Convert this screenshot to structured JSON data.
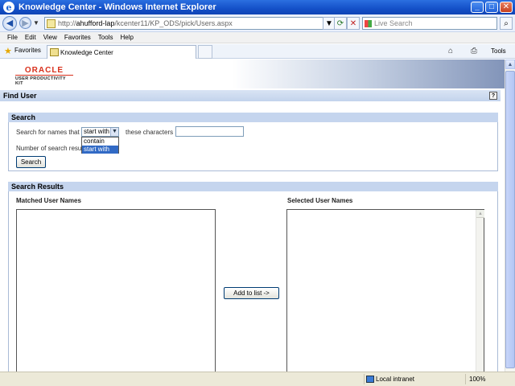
{
  "window": {
    "title": "Knowledge Center - Windows Internet Explorer",
    "controls": {
      "minimize": "_",
      "maximize": "□",
      "close": "✕"
    }
  },
  "address_bar": {
    "url_prefix": "http://",
    "url_host": "ahufford-lap",
    "url_path": "/kcenter11/KP_ODS/pick/Users.aspx",
    "search_placeholder": "Live Search"
  },
  "menu": [
    "File",
    "Edit",
    "View",
    "Favorites",
    "Tools",
    "Help"
  ],
  "favorites_bar": {
    "favorites_label": "Favorites",
    "tab_title": "Knowledge Center",
    "tools_label": "Tools"
  },
  "page": {
    "logo": {
      "brand": "ORACLE",
      "product": "USER PRODUCTIVITY KIT"
    },
    "find_title": "Find User",
    "help_label": "?",
    "search_section": {
      "title": "Search",
      "names_label": "Search for names that",
      "match_selected": "start with",
      "match_options": [
        "contain",
        "start with"
      ],
      "characters_label": "these characters",
      "characters_value": "",
      "results_count_label": "Number of search resul",
      "search_button": "Search"
    },
    "results_section": {
      "title": "Search Results",
      "matched_label": "Matched User Names",
      "selected_label": "Selected User Names",
      "matched_items": [],
      "selected_items": [],
      "add_button": "Add to list ->"
    }
  },
  "status_bar": {
    "zone": "Local intranet",
    "zoom": "100%"
  }
}
